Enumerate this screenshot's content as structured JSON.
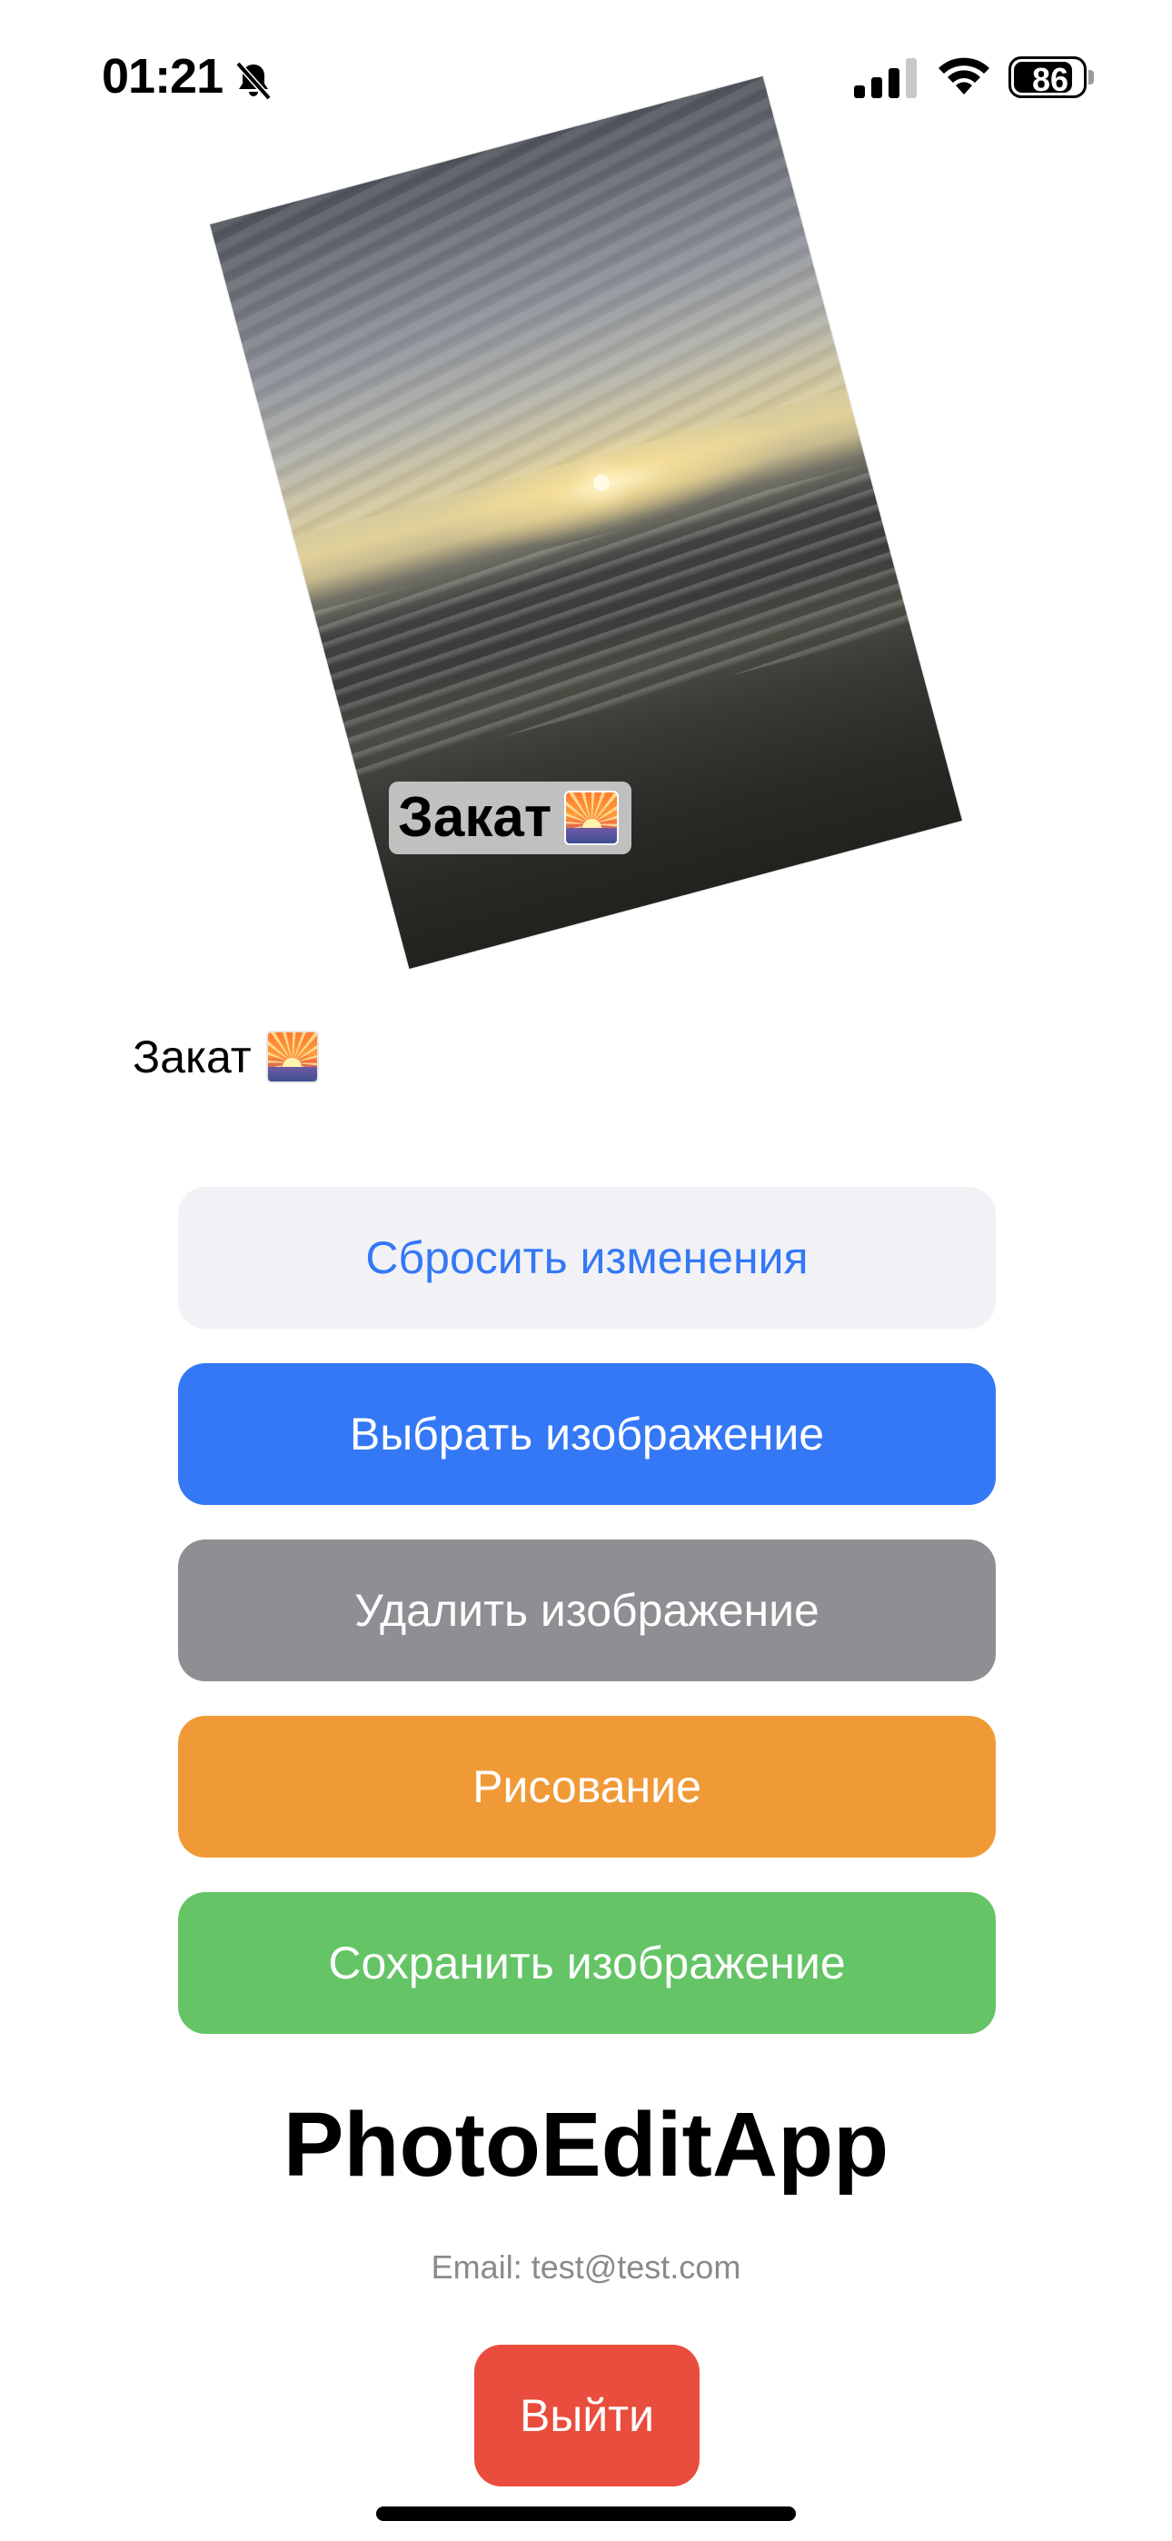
{
  "status_bar": {
    "time": "01:21",
    "battery_level": "86",
    "battery_fraction": 0.86,
    "icons": [
      "bell-slash-icon",
      "cellular-signal-icon",
      "wifi-icon",
      "battery-icon"
    ]
  },
  "photo": {
    "label_text": "Закат",
    "label_icon": "sunset-emoji-icon"
  },
  "caption": {
    "text": "Закат",
    "icon": "sunset-emoji-icon"
  },
  "buttons": {
    "reset": "Сбросить изменения",
    "choose": "Выбрать изображение",
    "delete": "Удалить изображение",
    "draw": "Рисование",
    "save": "Сохранить изображение",
    "logout": "Выйти"
  },
  "footer": {
    "app_name": "PhotoEditApp",
    "email": "Email: test@test.com"
  },
  "colors": {
    "accent_blue": "#3478f6",
    "reset_bg": "#f2f2f6",
    "delete_gray": "#8e8e93",
    "draw_orange": "#f09a37",
    "save_green": "#65c466",
    "logout_red": "#e94d3d"
  }
}
